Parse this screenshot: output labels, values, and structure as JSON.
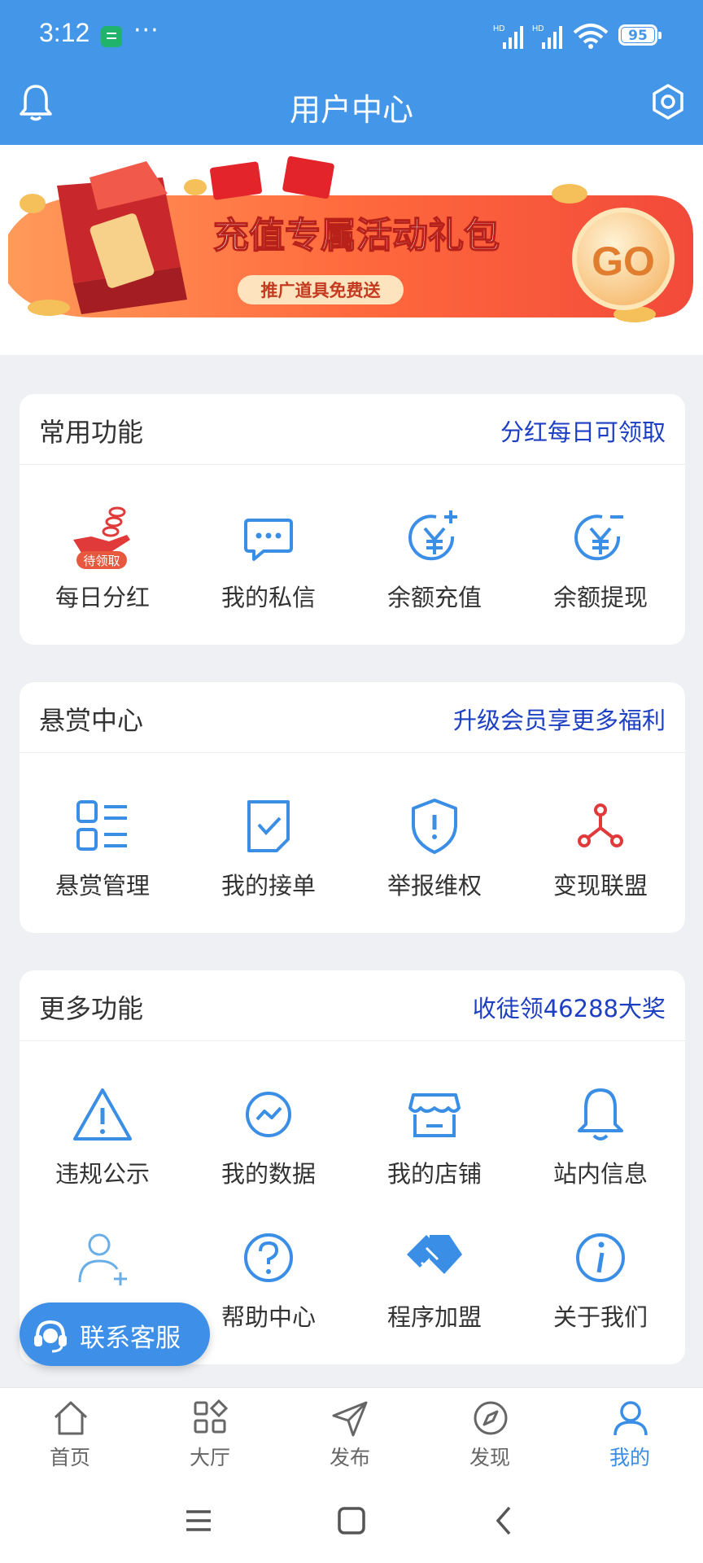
{
  "status_bar": {
    "time": "3:12",
    "dots": "···",
    "battery": "95"
  },
  "header": {
    "title": "用户中心"
  },
  "banner": {
    "headline": "充值专属活动礼包",
    "subline": "推广道具免费送",
    "go_label": "GO"
  },
  "sections": [
    {
      "title": "常用功能",
      "link": "分红每日可领取",
      "items": [
        {
          "label": "每日分红",
          "icon": "hand-coins-icon",
          "badge": "待领取"
        },
        {
          "label": "我的私信",
          "icon": "chat-bubble-icon"
        },
        {
          "label": "余额充值",
          "icon": "yen-plus-icon"
        },
        {
          "label": "余额提现",
          "icon": "yen-minus-icon"
        }
      ]
    },
    {
      "title": "悬赏中心",
      "link": "升级会员享更多福利",
      "items": [
        {
          "label": "悬赏管理",
          "icon": "list-icon"
        },
        {
          "label": "我的接单",
          "icon": "check-doc-icon"
        },
        {
          "label": "举报维权",
          "icon": "shield-icon"
        },
        {
          "label": "变现联盟",
          "icon": "network-icon"
        }
      ]
    },
    {
      "title": "更多功能",
      "link": "收徒领46288大奖",
      "items": [
        {
          "label": "违规公示",
          "icon": "warning-icon"
        },
        {
          "label": "我的数据",
          "icon": "chart-circle-icon"
        },
        {
          "label": "我的店铺",
          "icon": "store-icon"
        },
        {
          "label": "站内信息",
          "icon": "bell-icon"
        },
        {
          "label": "",
          "icon": "add-user-icon"
        },
        {
          "label": "帮助中心",
          "icon": "help-icon"
        },
        {
          "label": "程序加盟",
          "icon": "handshake-icon"
        },
        {
          "label": "关于我们",
          "icon": "info-icon"
        }
      ]
    }
  ],
  "floating": {
    "label": "联系客服"
  },
  "nav": [
    {
      "label": "首页",
      "icon": "home-icon"
    },
    {
      "label": "大厅",
      "icon": "apps-icon"
    },
    {
      "label": "发布",
      "icon": "send-icon"
    },
    {
      "label": "发现",
      "icon": "compass-icon"
    },
    {
      "label": "我的",
      "icon": "user-icon",
      "active": true
    }
  ],
  "colors": {
    "primary": "#4496e8",
    "link": "#1d3fc4",
    "accent_red": "#e03a3a",
    "icon_blue": "#3a8ee6"
  }
}
